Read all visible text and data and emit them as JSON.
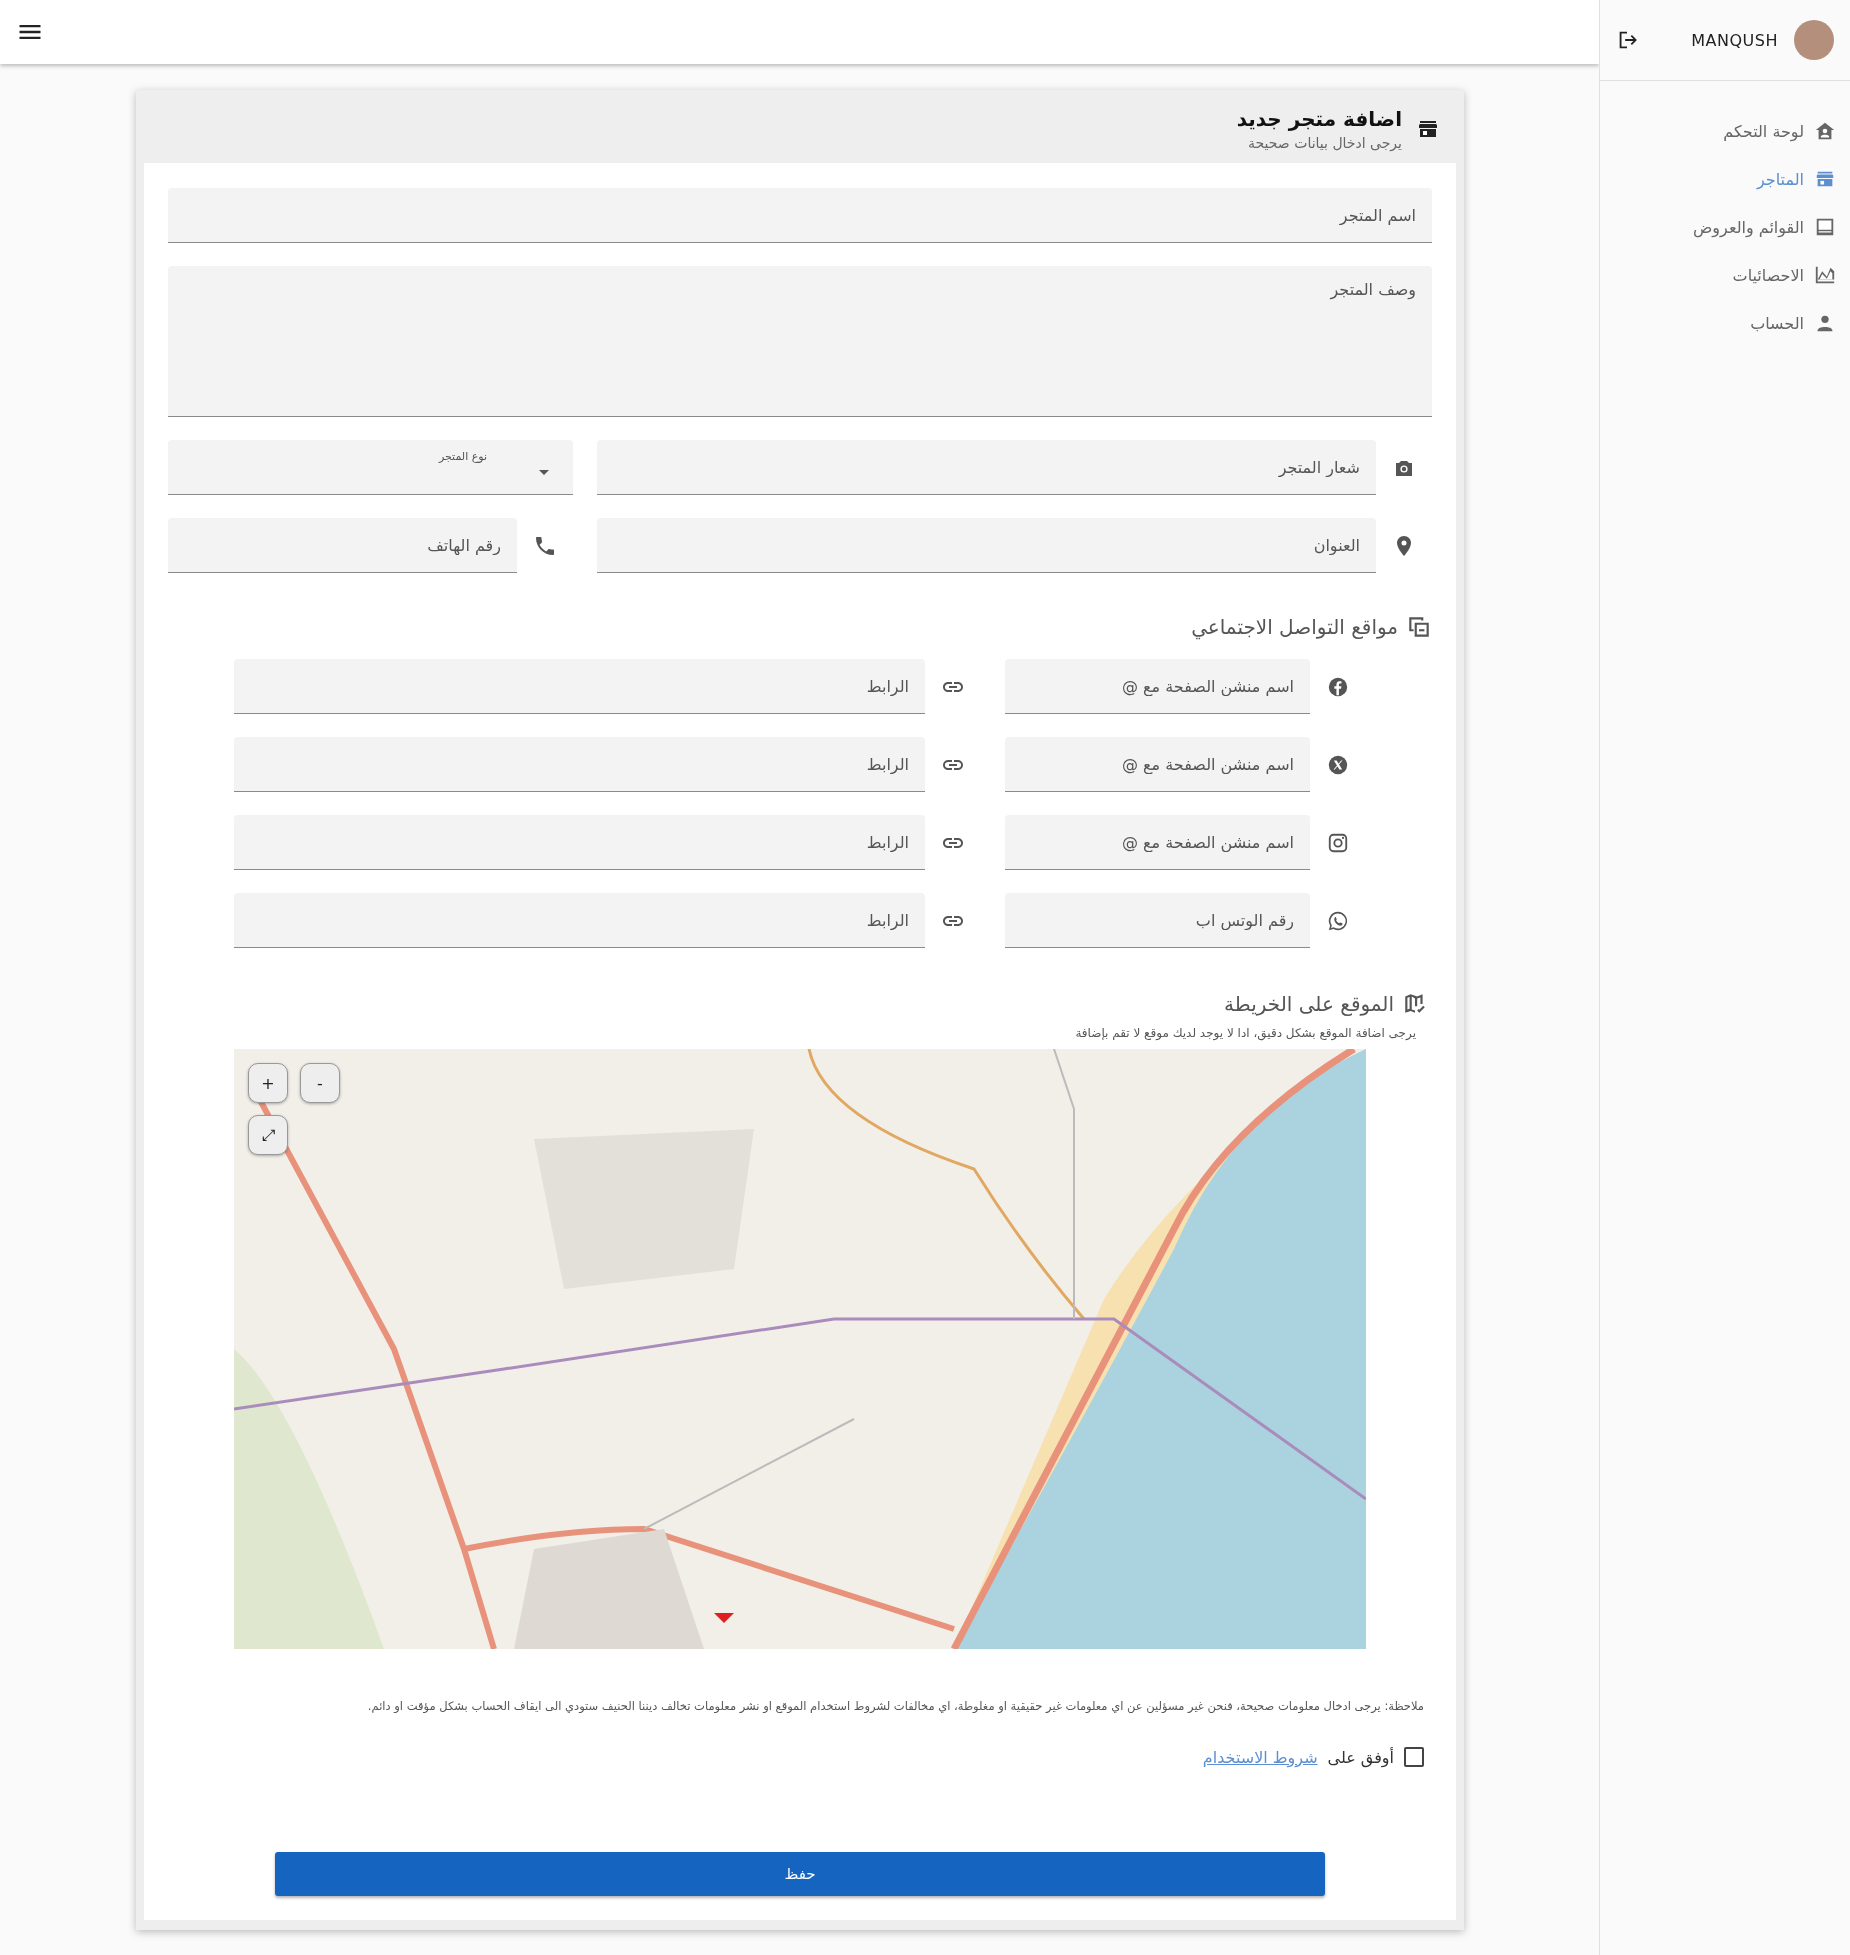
{
  "user": {
    "name": "MANQUSH"
  },
  "sidebar": {
    "items": [
      {
        "label": "لوحة التحكم",
        "kind": "home",
        "selected": false
      },
      {
        "label": "المتاجر",
        "kind": "store",
        "selected": true
      },
      {
        "label": "القوائم والعروض",
        "kind": "list",
        "selected": false
      },
      {
        "label": "الاحصائيات",
        "kind": "chart",
        "selected": false
      },
      {
        "label": "الحساب",
        "kind": "person",
        "selected": false
      }
    ]
  },
  "form": {
    "title": "اضافة متجر جديد",
    "subtitle": "يرجى ادخال بيانات صحيحة",
    "store_name": {
      "placeholder": "اسم المتجر"
    },
    "description": {
      "placeholder": "وصف المتجر"
    },
    "store_type": {
      "label": "نوع المتجر"
    },
    "logo": {
      "placeholder": "شعار المتجر"
    },
    "address": {
      "placeholder": "العنوان"
    },
    "phone": {
      "placeholder": "رقم الهاتف"
    }
  },
  "social": {
    "title": "مواقع التواصل الاجتماعي",
    "rows": [
      {
        "kind": "facebook",
        "name_placeholder": "اسم منشن الصفحة مع @",
        "link_placeholder": "الرابط"
      },
      {
        "kind": "x",
        "name_placeholder": "اسم منشن الصفحة مع @",
        "link_placeholder": "الرابط"
      },
      {
        "kind": "instagram",
        "name_placeholder": "اسم منشن الصفحة مع @",
        "link_placeholder": "الرابط"
      },
      {
        "kind": "whatsapp",
        "name_placeholder": "رقم الوتس اب",
        "link_placeholder": "الرابط"
      }
    ]
  },
  "map": {
    "title": "الموقع على الخريطة",
    "hint": "يرجى اضافة الموقع بشكل دقيق، ادا لا يوجد لديك موقع لا تقم بإضافة",
    "controls": [
      "+",
      "-",
      "⤢"
    ]
  },
  "note": "ملاحظة: يرجى ادخال معلومات صحيحة، فنحن غير مسؤلين عن اي معلومات غير حقيقية او مغلوطة، اي مخالفات لشروط استخدام الموقع او نشر معلومات تخالف ديننا الحنيف ستودي الى ايقاف الحساب بشكل مؤقت او دائم.",
  "terms": {
    "prefix": "أوفق على",
    "link": "شروط الاستخدام",
    "checked": false
  },
  "save_button": "حفظ"
}
